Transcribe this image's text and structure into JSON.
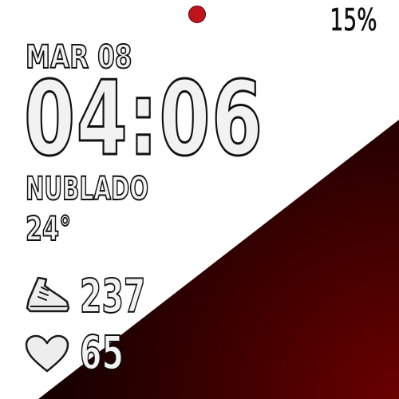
{
  "status": {
    "indicator_color": "#c0141c",
    "battery": "15%"
  },
  "date": "MAR 08",
  "time": "04:06",
  "weather": {
    "condition": "NUBLADO",
    "temperature": "24°"
  },
  "stats": {
    "steps": "237",
    "steps_icon": "shoe-icon",
    "heart_rate": "65",
    "heart_icon": "heart-icon"
  },
  "colors": {
    "background": "#ffffff",
    "panel_dark": "#000000",
    "panel_accent": "#6a0000",
    "text_fill": "#f2f2f2",
    "text_outline": "#111111"
  }
}
